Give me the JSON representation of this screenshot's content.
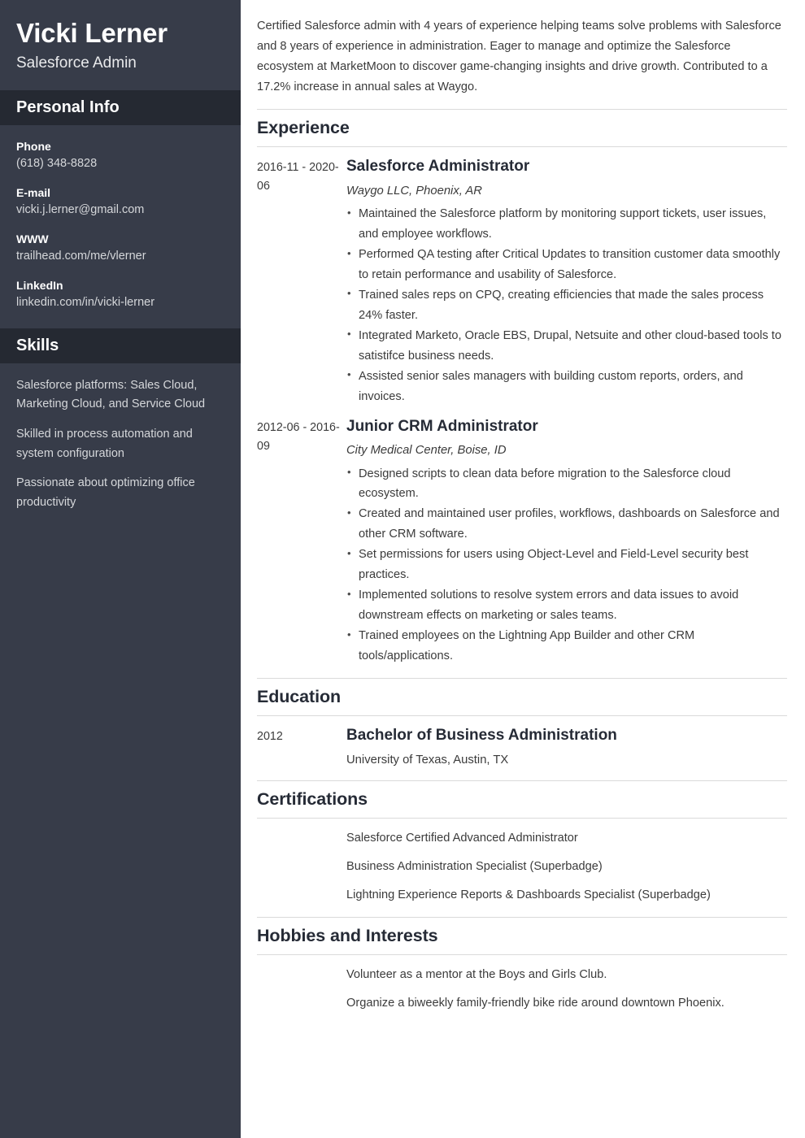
{
  "sidebar": {
    "name": "Vicki Lerner",
    "job_title": "Salesforce Admin",
    "personal_info": {
      "heading": "Personal Info",
      "items": [
        {
          "label": "Phone",
          "value": "(618) 348-8828"
        },
        {
          "label": "E-mail",
          "value": "vicki.j.lerner@gmail.com"
        },
        {
          "label": "WWW",
          "value": "trailhead.com/me/vlerner"
        },
        {
          "label": "LinkedIn",
          "value": "linkedin.com/in/vicki-lerner"
        }
      ]
    },
    "skills": {
      "heading": "Skills",
      "items": [
        "Salesforce platforms: Sales Cloud, Marketing Cloud, and Service Cloud",
        "Skilled in process automation and system configuration",
        "Passionate about optimizing office productivity"
      ]
    }
  },
  "main": {
    "summary": "Certified Salesforce admin with 4 years of experience helping teams solve problems with Salesforce and 8 years of experience in administration. Eager to manage and optimize the Salesforce ecosystem at MarketMoon to discover game-changing insights and drive growth. Contributed to a 17.2% increase in annual sales at Waygo.",
    "experience": {
      "heading": "Experience",
      "entries": [
        {
          "date": "2016-11 - 2020-06",
          "title": "Salesforce Administrator",
          "subtitle": "Waygo LLC, Phoenix, AR",
          "bullets": [
            "Maintained the Salesforce platform by monitoring support tickets, user issues, and employee workflows.",
            "Performed QA testing after Critical Updates to transition customer data smoothly to retain performance and usability of Salesforce.",
            "Trained sales reps on CPQ, creating efficiencies that made the sales process 24% faster.",
            "Integrated Marketo, Oracle EBS, Drupal, Netsuite and other cloud-based tools to satistifce business needs.",
            "Assisted senior sales managers with building custom reports, orders, and invoices."
          ]
        },
        {
          "date": "2012-06 - 2016-09",
          "title": "Junior CRM Administrator",
          "subtitle": "City Medical Center, Boise, ID",
          "bullets": [
            "Designed scripts to clean data before migration to the Salesforce cloud ecosystem.",
            "Created and maintained user profiles, workflows, dashboards on Salesforce and other CRM software.",
            "Set permissions for users using Object-Level and Field-Level security best practices.",
            "Implemented solutions to resolve system errors and data issues to avoid downstream effects on marketing or sales teams.",
            "Trained employees on the Lightning App Builder and other CRM tools/applications."
          ]
        }
      ]
    },
    "education": {
      "heading": "Education",
      "entries": [
        {
          "date": "2012",
          "title": "Bachelor of Business Administration",
          "subtitle": "University of Texas, Austin, TX"
        }
      ]
    },
    "certifications": {
      "heading": "Certifications",
      "items": [
        "Salesforce Certified Advanced Administrator",
        "Business Administration Specialist (Superbadge)",
        "Lightning Experience Reports & Dashboards Specialist (Superbadge)"
      ]
    },
    "hobbies": {
      "heading": "Hobbies and Interests",
      "items": [
        "Volunteer as a mentor at the Boys and Girls Club.",
        "Organize a biweekly family-friendly bike ride around downtown Phoenix."
      ]
    }
  },
  "colors": {
    "sidebar_bg": "#373c49",
    "sidebar_header_bg": "#252932",
    "heading_text": "#262b36",
    "body_text": "#3b3b3b",
    "rule": "#dadada"
  }
}
